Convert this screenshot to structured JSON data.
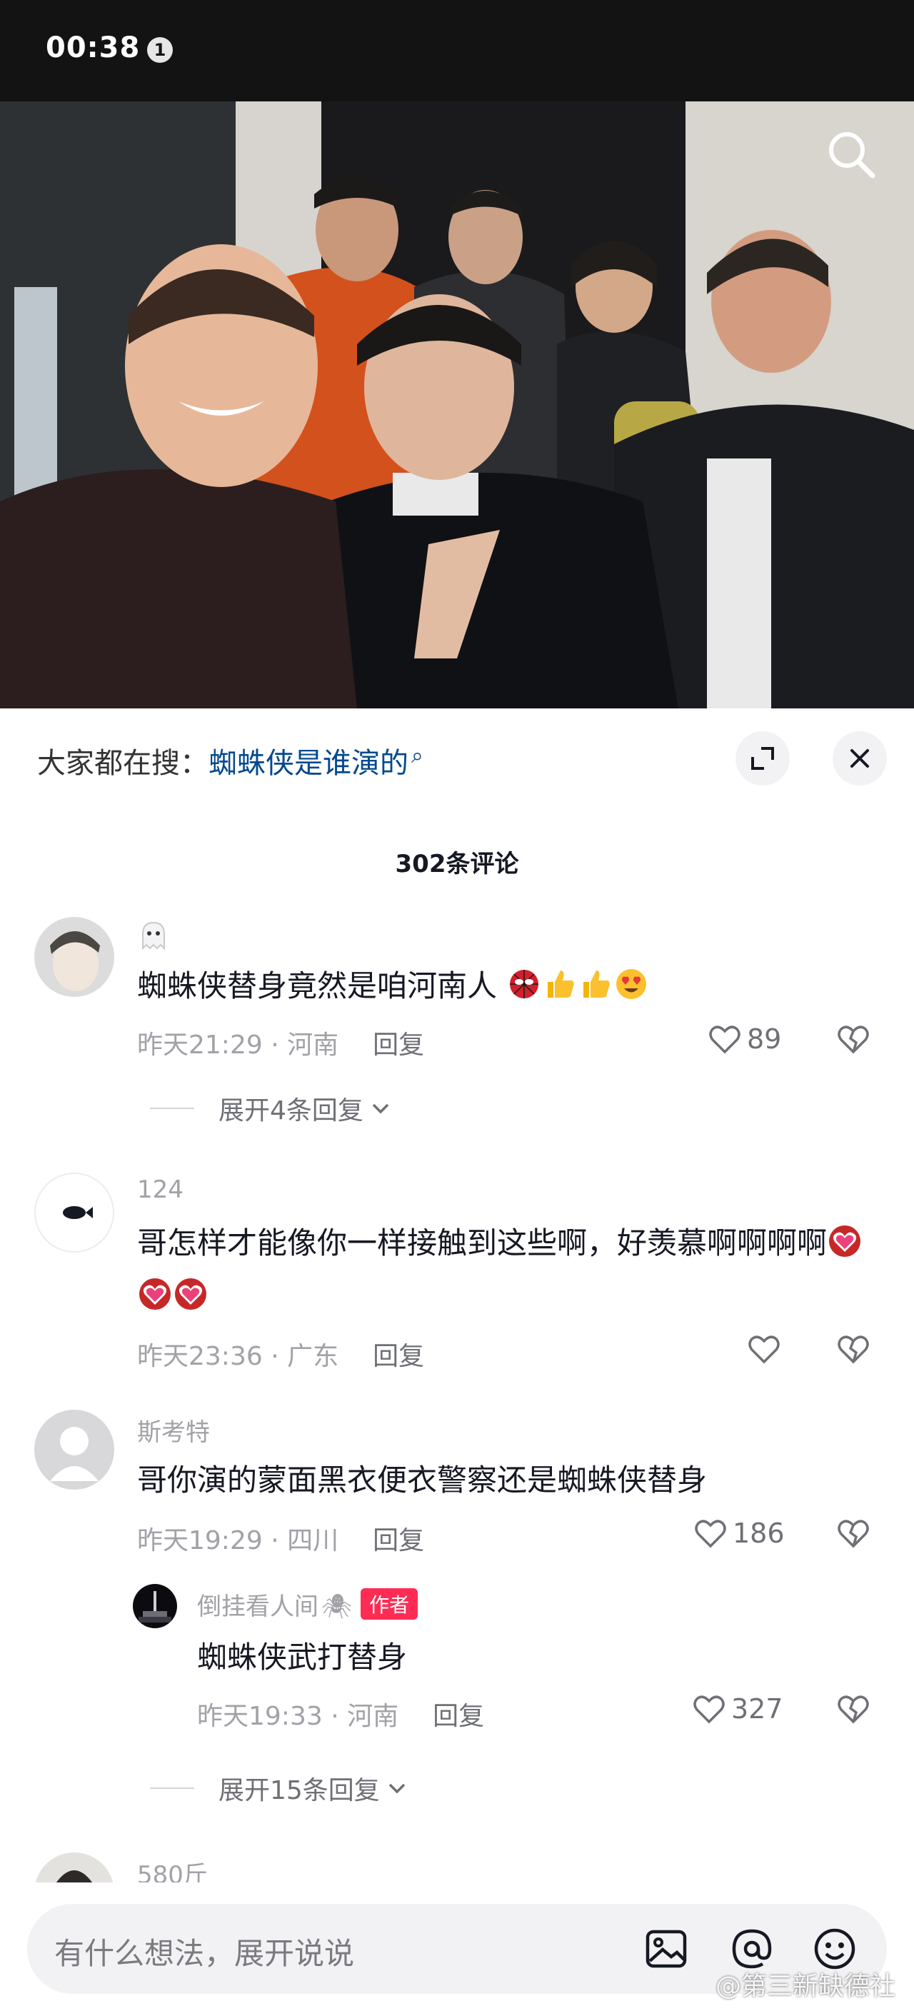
{
  "status_bar": {
    "time": "00:38",
    "notification_count": "1"
  },
  "hot_search": {
    "label": "大家都在搜：",
    "query": "蜘蛛侠是谁演的"
  },
  "comment_count": "302条评论",
  "comments": [
    {
      "username": "",
      "text": "蜘蛛侠替身竟然是咱河南人",
      "time_location": "昨天21:29 · 河南",
      "reply_label": "回复",
      "likes": "89",
      "expand_label": "展开4条回复"
    },
    {
      "username": "124",
      "text": "哥怎样才能像你一样接触到这些啊，好羡慕啊啊啊啊",
      "time_location": "昨天23:36 · 广东",
      "reply_label": "回复",
      "likes": ""
    },
    {
      "username": "斯考特",
      "text": "哥你演的蒙面黑衣便衣警察还是蜘蛛侠替身",
      "time_location": "昨天19:29 · 四川",
      "reply_label": "回复",
      "likes": "186",
      "reply": {
        "username": "倒挂看人间",
        "badge": "作者",
        "text": "蜘蛛侠武打替身",
        "time_location": "昨天19:33 · 河南",
        "reply_label": "回复",
        "likes": "327"
      },
      "expand_label": "展开15条回复"
    },
    {
      "username": "580斤"
    }
  ],
  "input_bar": {
    "placeholder": "有什么想法，展开说说"
  },
  "watermark": "@第三新缺德社",
  "icons": [
    "search-icon",
    "expand-icon",
    "close-icon",
    "heart-icon",
    "broken-heart-icon",
    "chevron-down-icon",
    "image-icon",
    "at-icon",
    "emoji-icon"
  ]
}
